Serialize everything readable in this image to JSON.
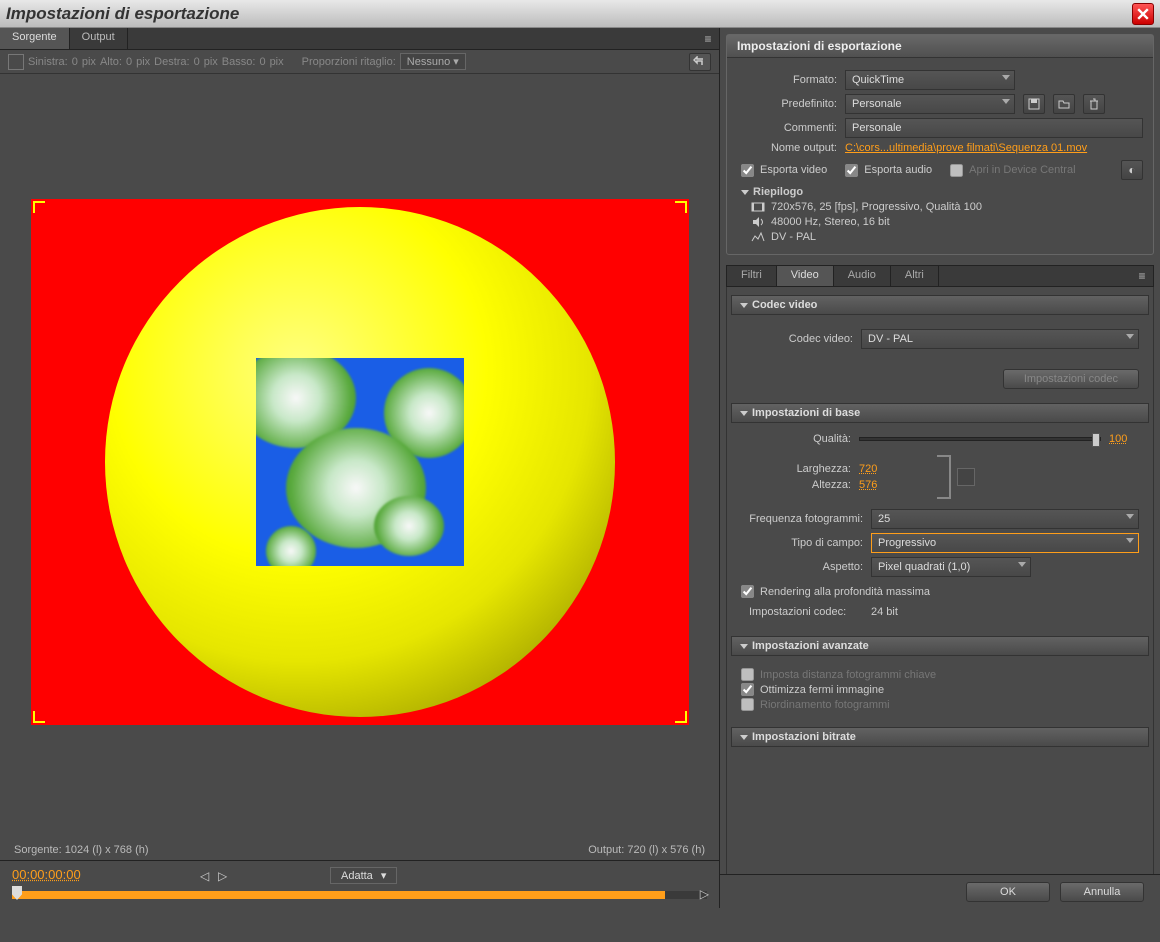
{
  "window": {
    "title": "Impostazioni di esportazione"
  },
  "leftTabs": {
    "source": "Sorgente",
    "output": "Output"
  },
  "cropBar": {
    "left": "Sinistra:",
    "leftVal": "0",
    "leftUnit": "pix",
    "top": "Alto:",
    "topVal": "0",
    "topUnit": "pix",
    "right": "Destra:",
    "rightVal": "0",
    "rightUnit": "pix",
    "bottom": "Basso:",
    "bottomVal": "0",
    "bottomUnit": "pix",
    "ratio": "Proporzioni ritaglio:",
    "ratioVal": "Nessuno"
  },
  "status": {
    "source": "Sorgente: 1024 (l) x 768 (h)",
    "output": "Output: 720 (l) x 576 (h)"
  },
  "timeline": {
    "timecode": "00:00:00:00",
    "fit": "Adatta"
  },
  "export": {
    "header": "Impostazioni di esportazione",
    "format": {
      "label": "Formato:",
      "value": "QuickTime"
    },
    "preset": {
      "label": "Predefinito:",
      "value": "Personale"
    },
    "comment": {
      "label": "Commenti:",
      "value": "Personale"
    },
    "outputName": {
      "label": "Nome output:",
      "value": "C:\\cors...ultimedia\\prove filmati\\Sequenza 01.mov"
    },
    "exportVideo": "Esporta video",
    "exportAudio": "Esporta audio",
    "openDevice": "Apri in Device Central",
    "summary": {
      "header": "Riepilogo",
      "line1": "720x576, 25 [fps], Progressivo, Qualità 100",
      "line2": "48000 Hz, Stereo, 16 bit",
      "line3": "DV - PAL"
    }
  },
  "subTabs": {
    "filters": "Filtri",
    "video": "Video",
    "audio": "Audio",
    "other": "Altri"
  },
  "videoCodec": {
    "header": "Codec video",
    "label": "Codec video:",
    "value": "DV - PAL",
    "settingsBtn": "Impostazioni codec"
  },
  "basic": {
    "header": "Impostazioni di base",
    "quality": {
      "label": "Qualità:",
      "value": "100"
    },
    "width": {
      "label": "Larghezza:",
      "value": "720"
    },
    "height": {
      "label": "Altezza:",
      "value": "576"
    },
    "fps": {
      "label": "Frequenza fotogrammi:",
      "value": "25"
    },
    "field": {
      "label": "Tipo di campo:",
      "value": "Progressivo"
    },
    "aspect": {
      "label": "Aspetto:",
      "value": "Pixel quadrati (1,0)"
    },
    "maxDepth": "Rendering alla profondità massima",
    "codecSet": {
      "label": "Impostazioni codec:",
      "value": "24 bit"
    }
  },
  "advanced": {
    "header": "Impostazioni avanzate",
    "keyframe": "Imposta distanza fotogrammi chiave",
    "optimize": "Ottimizza fermi immagine",
    "reorder": "Riordinamento fotogrammi"
  },
  "bitrate": {
    "header": "Impostazioni bitrate"
  },
  "footer": {
    "ok": "OK",
    "cancel": "Annulla"
  }
}
